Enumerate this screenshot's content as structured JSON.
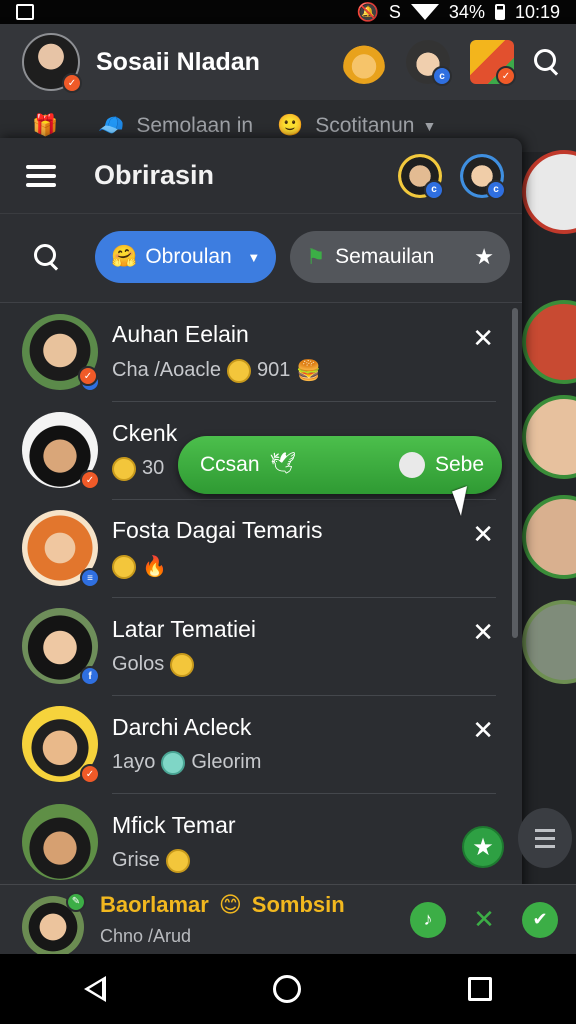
{
  "status_bar": {
    "battery": "34%",
    "time": "10:19",
    "carrier_glyph": "S"
  },
  "top_bar": {
    "title": "Sosaii Nladan"
  },
  "background_row": {
    "left_label": "Semolaan in",
    "right_label": "Scotitanun"
  },
  "panel": {
    "title": "Obrirasin",
    "filters": [
      {
        "label": "Obroulan",
        "active": true
      },
      {
        "label": "Semauilan",
        "active": false
      }
    ]
  },
  "contacts": [
    {
      "name": "Auhan Eelain",
      "subtitle": "Cha /Aoacle",
      "extra": "901",
      "closable": true
    },
    {
      "name": "Ckenk",
      "subtitle": "",
      "extra": "30",
      "closable": false
    },
    {
      "name": "Fosta Dagai Temaris",
      "subtitle": "",
      "extra": "",
      "closable": true
    },
    {
      "name": "Latar Tematiei",
      "subtitle": "Golos",
      "extra": "",
      "closable": true
    },
    {
      "name": "Darchi Acleck",
      "subtitle": "1ayo",
      "extra": "Gleorim",
      "closable": true
    },
    {
      "name": "Mfick Temar",
      "subtitle": "Grise",
      "extra": "",
      "closable": false
    }
  ],
  "action_pill": {
    "left_label": "Ccsan",
    "right_label": "Sebe"
  },
  "bottom_bar": {
    "name": "Baorlamar",
    "tag": "Sombsin",
    "subtitle": "Chno /Arud"
  },
  "colors": {
    "accent_blue": "#3d7de0",
    "accent_green": "#3cae46",
    "badge_orange": "#f05a28",
    "highlight_gold": "#f2b81f"
  }
}
